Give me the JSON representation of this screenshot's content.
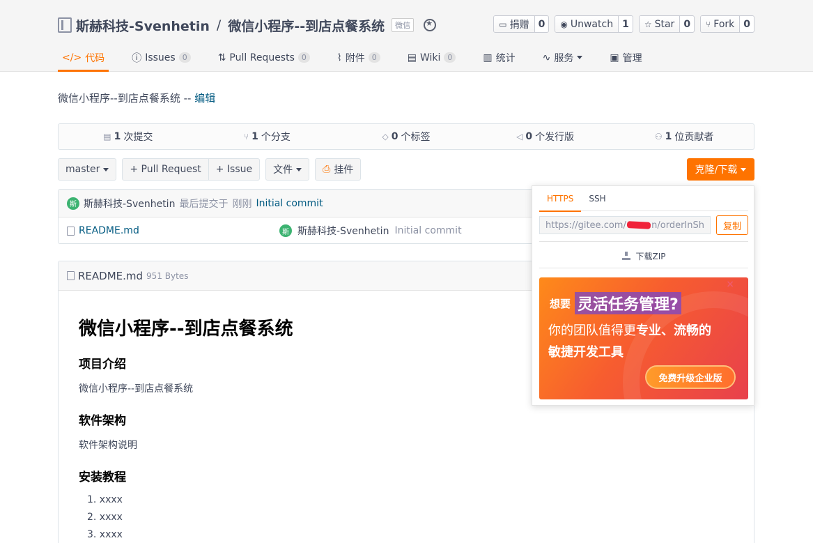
{
  "repo": {
    "owner": "斯赫科技-Svenhetin",
    "separator": "/",
    "name": "微信小程序--到店点餐系统",
    "badge": "微信"
  },
  "actions": [
    {
      "label": "捐赠",
      "count": "0",
      "icon": "donate-icon"
    },
    {
      "label": "Unwatch",
      "count": "1",
      "icon": "eye-icon"
    },
    {
      "label": "Star",
      "count": "0",
      "icon": "star-icon"
    },
    {
      "label": "Fork",
      "count": "0",
      "icon": "fork-icon"
    }
  ],
  "tabs": [
    {
      "label": "代码",
      "icon": "code-icon",
      "active": true
    },
    {
      "label": "Issues",
      "badge": "0",
      "icon": "issue-icon"
    },
    {
      "label": "Pull Requests",
      "badge": "0",
      "icon": "pr-icon"
    },
    {
      "label": "附件",
      "badge": "0",
      "icon": "attachment-icon"
    },
    {
      "label": "Wiki",
      "badge": "0",
      "icon": "wiki-icon"
    },
    {
      "label": "统计",
      "icon": "chart-icon"
    },
    {
      "label": "服务",
      "icon": "pulse-icon"
    },
    {
      "label": "管理",
      "icon": "manage-icon"
    }
  ],
  "description": {
    "text": "微信小程序--到店点餐系统 --",
    "edit": "编辑"
  },
  "stats": [
    {
      "count": "1",
      "label": "次提交",
      "icon": "commits-icon"
    },
    {
      "count": "1",
      "label": "个分支",
      "icon": "branch-icon"
    },
    {
      "count": "0",
      "label": "个标签",
      "icon": "tag-icon"
    },
    {
      "count": "0",
      "label": "个发行版",
      "icon": "release-icon"
    },
    {
      "count": "1",
      "label": "位贡献者",
      "icon": "contributors-icon"
    }
  ],
  "toolbar": {
    "branch": "master",
    "pull_request": "+ Pull Request",
    "issue": "+ Issue",
    "file": "文件",
    "widget": "挂件",
    "clone": "克隆/下载"
  },
  "last_commit": {
    "avatar": "斯",
    "author": "斯赫科技-Svenhetin",
    "meta": "最后提交于",
    "time": "刚刚",
    "message": "Initial commit"
  },
  "files": [
    {
      "name": "README.md",
      "avatar": "斯",
      "author": "斯赫科技-Svenhetin",
      "message": "Initial commit"
    }
  ],
  "readme": {
    "filename": "README.md",
    "size": "951 Bytes",
    "h1": "微信小程序--到店点餐系统",
    "intro_heading": "项目介绍",
    "intro_text": "微信小程序--到店点餐系统",
    "arch_heading": "软件架构",
    "arch_text": "软件架构说明",
    "install_heading": "安装教程",
    "install_steps": [
      "1. xxxx",
      "2. xxxx",
      "3. xxxx"
    ]
  },
  "clone_dropdown": {
    "tab_https": "HTTPS",
    "tab_ssh": "SSH",
    "url_prefix": "https://gitee.com/",
    "url_suffix": "n/orderInSh",
    "copy": "复制",
    "download_zip": "下载ZIP"
  },
  "ad": {
    "want": "想要",
    "highlight": "灵活任务管理?",
    "line2_a": "你的团队值得更",
    "line2_b": "专业、流畅的",
    "line3": "敏捷开发工具",
    "button": "免费升级企业版",
    "close": "×"
  },
  "colors": {
    "accent": "#fe7300",
    "link": "#005980",
    "text": "#40485b"
  }
}
